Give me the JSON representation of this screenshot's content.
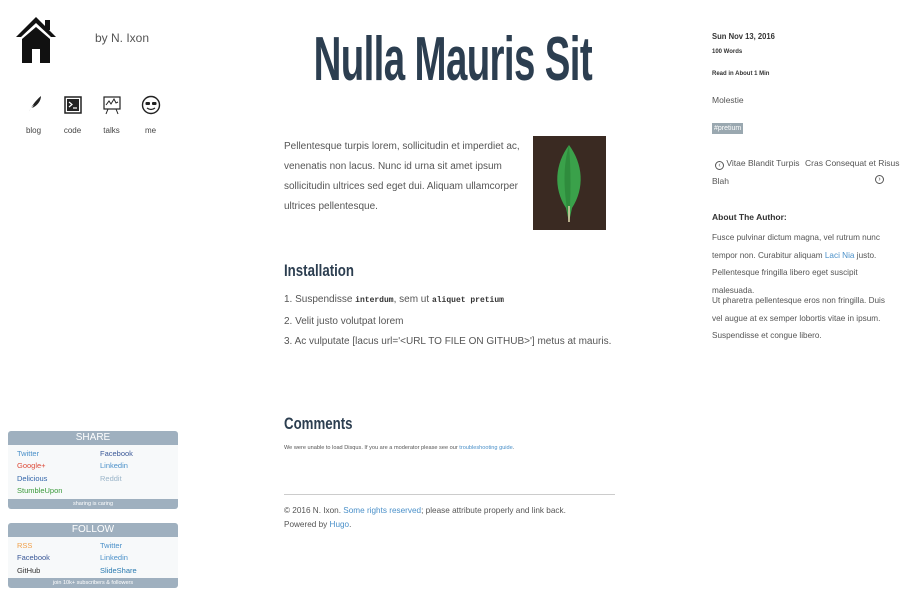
{
  "site": {
    "byline": "by N. Ixon",
    "nav": [
      {
        "label": "blog",
        "icon": "feather-icon"
      },
      {
        "label": "code",
        "icon": "terminal-icon"
      },
      {
        "label": "talks",
        "icon": "presentation-icon"
      },
      {
        "label": "me",
        "icon": "smiley-icon"
      }
    ]
  },
  "share": {
    "title": "SHARE",
    "links": [
      {
        "label": "Twitter",
        "color": "#4a90c9"
      },
      {
        "label": "Facebook",
        "color": "#3b5998"
      },
      {
        "label": "Google+",
        "color": "#dd4b39"
      },
      {
        "label": "Linkedin",
        "color": "#4a90c9"
      },
      {
        "label": "Delicious",
        "color": "#3366aa"
      },
      {
        "label": "Reddit",
        "color": "#9bb5c9"
      },
      {
        "label": "StumbleUpon",
        "color": "#3a9a3a"
      }
    ],
    "footer": "sharing is caring"
  },
  "follow": {
    "title": "FOLLOW",
    "links": [
      {
        "label": "RSS",
        "color": "#f0a04a"
      },
      {
        "label": "Twitter",
        "color": "#4a90c9"
      },
      {
        "label": "Facebook",
        "color": "#3b5998"
      },
      {
        "label": "Linkedin",
        "color": "#4a90c9"
      },
      {
        "label": "GitHub",
        "color": "#333333"
      },
      {
        "label": "SlideShare",
        "color": "#2a7ab0"
      }
    ],
    "footer": "join 10k+ subscribers & followers"
  },
  "post": {
    "title": "Nulla Mauris Sit",
    "intro": "Pellentesque turpis lorem, sollicitudin et imperdiet ac, venenatis non lacus. Nunc id urna sit amet ipsum sollicitudin ultrices sed eget dui. Aliquam ullamcorper ultrices pellentesque.",
    "installation_heading": "Installation",
    "steps": {
      "s1_pre": "1. Suspendisse ",
      "s1_code1": "interdum",
      "s1_mid": ", sem ut ",
      "s1_code2": "aliquet pretium",
      "s2": "2. Velit justo volutpat lorem",
      "s3": "3. Ac vulputate [lacus url='<URL TO FILE ON GITHUB>'] metus at mauris."
    },
    "comments_heading": "Comments",
    "disqus_text": "We were unable to load Disqus. If you are a moderator please see our ",
    "disqus_link": "troubleshooting guide",
    "disqus_end": "."
  },
  "footer": {
    "copyright": "© 2016 N. Ixon.",
    "rights_link": "Some rights reserved",
    "rights_after": "; please attribute properly and link back.",
    "powered": "Powered by",
    "hugo": "Hugo",
    "powered_end": "."
  },
  "meta": {
    "date": "Sun Nov 13, 2016",
    "words": "100 Words",
    "read": "Read in About 1 Min",
    "category": "Molestie",
    "tag": "#pretium",
    "prev_label": "Vitae Blandit Turpis",
    "next_label_1": "Cras Consequat et Risus",
    "next_label_2": "Blah",
    "about_heading": "About The Author:",
    "about_p1_a": "Fusce pulvinar dictum magna, vel rutrum nunc tempor non. Curabitur aliquam ",
    "about_p1_link": "Laci Nia",
    "about_p1_b": " justo. Pellentesque fringilla libero eget suscipit malesuada.",
    "about_p2": "Ut pharetra pellentesque eros non fringilla. Duis vel augue at ex semper lobortis vitae in ipsum. Suspendisse et congue libero."
  },
  "colors": {
    "title": "#2c3e50",
    "link": "#4a90c9",
    "box_header": "#9fb0bf",
    "leaf_bg": "#3a2a22",
    "leaf": "#3aa14a"
  }
}
